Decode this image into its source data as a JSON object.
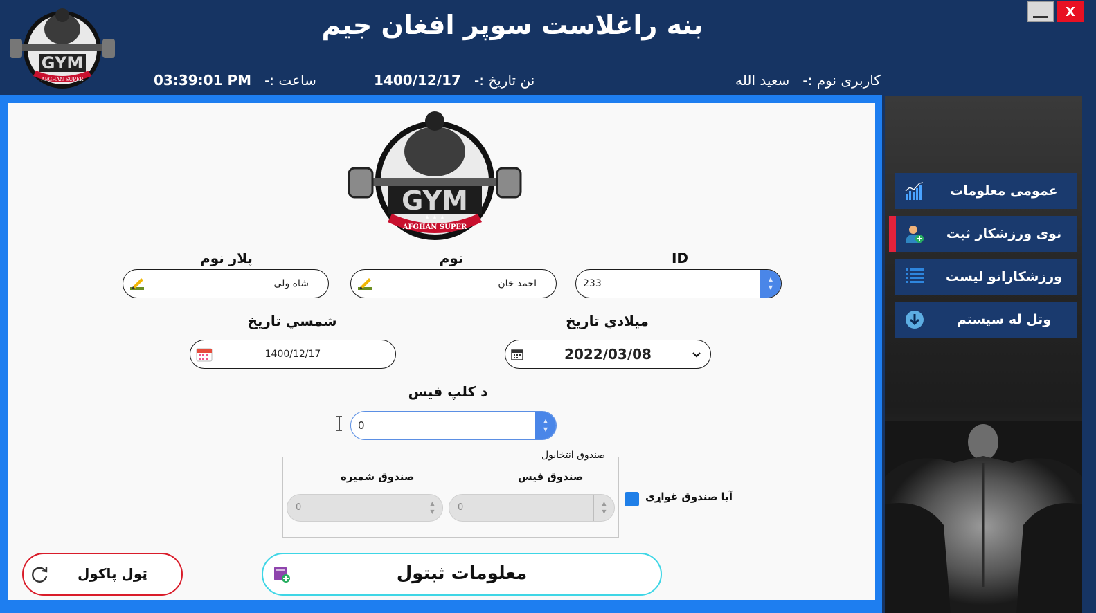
{
  "app": {
    "title": "بنه راغلاست سوپر افغان جیم"
  },
  "window_controls": {
    "minimize_icon": "minimize-icon",
    "close_label": "X"
  },
  "header": {
    "user_label": "کاربری نوم :-",
    "user_value": "سعید الله",
    "date_label": "نن تاریخ :-",
    "date_value": "1400/12/17",
    "time_label": "ساعت :-",
    "time_value": "03:39:01 PM"
  },
  "logo": {
    "text": "GYM",
    "subtext": "AFGHAN SUPER"
  },
  "form": {
    "id_label": "ID",
    "id_value": "233",
    "name_label": "نوم",
    "name_value": "احمد خان",
    "father_label": "پلار نوم",
    "father_value": "شاه ولی",
    "gregorian_label": "میلادي تاریخ",
    "gregorian_value": "2022/03/08",
    "shamsi_label": "شمسي تاریخ",
    "shamsi_value": "1400/12/17",
    "fee_label": "د کلپ فیس",
    "fee_value": "0"
  },
  "locker_group": {
    "title": "صندوق انتخابول",
    "fee_label": "صندوق فیس",
    "fee_value": "0",
    "number_label": "صندوق شمیره",
    "number_value": "0",
    "checkbox_label": "آیا صندوق غواړی",
    "checked": true
  },
  "actions": {
    "save_label": "معلومات ثبتول",
    "clear_label": "ټول پاکول"
  },
  "sidebar": {
    "items": [
      {
        "label": "عمومی معلومات",
        "icon": "chart-icon",
        "active": false
      },
      {
        "label": "نوی ورزشکار ثبت",
        "icon": "add-user-icon",
        "active": true
      },
      {
        "label": "ورزشکارانو لیست",
        "icon": "list-icon",
        "active": false
      },
      {
        "label": "وتل له سیستم",
        "icon": "exit-down-icon",
        "active": false
      }
    ]
  },
  "colors": {
    "header_bg": "#163463",
    "panel_border": "#1e7ef0",
    "spin_accent": "#4a86e8",
    "sidebar_item": "#1a3a6e",
    "active_marker": "#e3223b",
    "clear_border": "#d91c2a",
    "save_border": "#3ed6e6"
  }
}
